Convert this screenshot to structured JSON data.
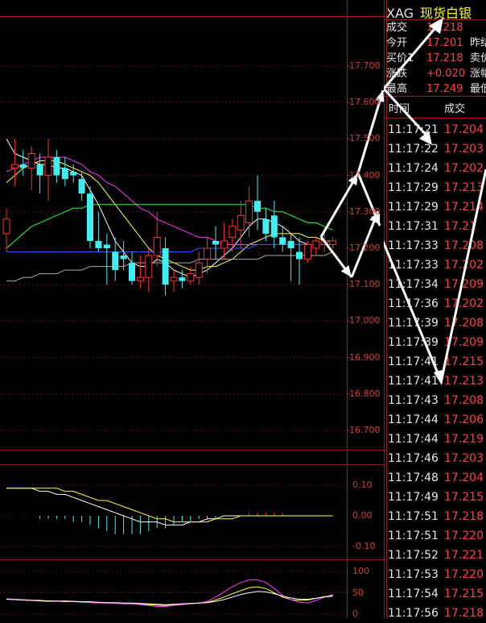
{
  "colors": {
    "up": "#ff3030",
    "down": "#40f0f0",
    "grid": "#8b1a1a",
    "ma5": "#ffffff",
    "ma10": "#ffff33",
    "ma20": "#ff33ff",
    "ma40": "#33ff33",
    "ma60": "#3355ff",
    "ma120": "#aaaaaa",
    "price_text": "#ff4040",
    "label_text": "#e6e6e6",
    "symbol_name": "#ffff00"
  },
  "header": {
    "symbol": "XAG",
    "name": "现货白银"
  },
  "quote": [
    {
      "label": "成交",
      "value": "17.218",
      "label2": ""
    },
    {
      "label": "今开",
      "value": "17.201",
      "label2": "昨结"
    },
    {
      "label": "买价1",
      "value": "17.218",
      "label2": "卖价"
    },
    {
      "label": "涨跌",
      "value": "+0.020",
      "label2": "涨幅"
    },
    {
      "label": "最高",
      "value": "17.249",
      "label2": "最低"
    }
  ],
  "ticks_header": {
    "time": "时间",
    "price": "成交"
  },
  "ticks": [
    {
      "time": "11:17:21",
      "price": "17.204"
    },
    {
      "time": "11:17:22",
      "price": "17.203"
    },
    {
      "time": "11:17:24",
      "price": "17.202"
    },
    {
      "time": "11:17:29",
      "price": "17.213"
    },
    {
      "time": "11:17:29",
      "price": "17.214"
    },
    {
      "time": "11:17:31",
      "price": "17.21"
    },
    {
      "time": "11:17:33",
      "price": "17.208"
    },
    {
      "time": "11:17:33",
      "price": "17.202"
    },
    {
      "time": "11:17:34",
      "price": "17.209"
    },
    {
      "time": "11:17:36",
      "price": "17.202"
    },
    {
      "time": "11:17:39",
      "price": "17.208"
    },
    {
      "time": "11:17:39",
      "price": "17.209"
    },
    {
      "time": "11:17:41",
      "price": "17.215"
    },
    {
      "time": "11:17:41",
      "price": "17.213"
    },
    {
      "time": "11:17:43",
      "price": "17.208"
    },
    {
      "time": "11:17:44",
      "price": "17.206"
    },
    {
      "time": "11:17:44",
      "price": "17.219"
    },
    {
      "time": "11:17:46",
      "price": "17.203"
    },
    {
      "time": "11:17:48",
      "price": "17.204"
    },
    {
      "time": "11:17:49",
      "price": "17.215"
    },
    {
      "time": "11:17:51",
      "price": "17.218"
    },
    {
      "time": "11:17:51",
      "price": "17.220"
    },
    {
      "time": "11:17:52",
      "price": "17.221"
    },
    {
      "time": "11:17:53",
      "price": "17.220"
    },
    {
      "time": "11:17:54",
      "price": "17.215"
    },
    {
      "time": "11:17:56",
      "price": "17.218"
    }
  ],
  "chart_data": [
    {
      "type": "candlestick",
      "y_ticks": [
        "17.700",
        "17.600",
        "17.500",
        "17.400",
        "17.300",
        "17.200",
        "17.100",
        "17.000",
        "16.900",
        "16.800",
        "16.700"
      ],
      "ylim": [
        16.66,
        17.79
      ],
      "candles": [
        {
          "o": 17.24,
          "h": 17.31,
          "l": 17.19,
          "c": 17.28
        },
        {
          "o": 17.42,
          "h": 17.5,
          "l": 17.37,
          "c": 17.43
        },
        {
          "o": 17.43,
          "h": 17.47,
          "l": 17.4,
          "c": 17.42
        },
        {
          "o": 17.42,
          "h": 17.48,
          "l": 17.36,
          "c": 17.46
        },
        {
          "o": 17.43,
          "h": 17.46,
          "l": 17.35,
          "c": 17.4
        },
        {
          "o": 17.4,
          "h": 17.5,
          "l": 17.33,
          "c": 17.45
        },
        {
          "o": 17.45,
          "h": 17.47,
          "l": 17.38,
          "c": 17.4
        },
        {
          "o": 17.42,
          "h": 17.45,
          "l": 17.37,
          "c": 17.39
        },
        {
          "o": 17.41,
          "h": 17.43,
          "l": 17.38,
          "c": 17.4
        },
        {
          "o": 17.39,
          "h": 17.41,
          "l": 17.33,
          "c": 17.35
        },
        {
          "o": 17.35,
          "h": 17.37,
          "l": 17.2,
          "c": 17.22
        },
        {
          "o": 17.22,
          "h": 17.3,
          "l": 17.19,
          "c": 17.2
        },
        {
          "o": 17.21,
          "h": 17.24,
          "l": 17.1,
          "c": 17.2
        },
        {
          "o": 17.19,
          "h": 17.23,
          "l": 17.11,
          "c": 17.14
        },
        {
          "o": 17.18,
          "h": 17.22,
          "l": 17.14,
          "c": 17.17
        },
        {
          "o": 17.16,
          "h": 17.19,
          "l": 17.1,
          "c": 17.11
        },
        {
          "o": 17.11,
          "h": 17.18,
          "l": 17.09,
          "c": 17.12
        },
        {
          "o": 17.12,
          "h": 17.2,
          "l": 17.08,
          "c": 17.18
        },
        {
          "o": 17.18,
          "h": 17.3,
          "l": 17.15,
          "c": 17.23
        },
        {
          "o": 17.2,
          "h": 17.23,
          "l": 17.07,
          "c": 17.1
        },
        {
          "o": 17.11,
          "h": 17.14,
          "l": 17.08,
          "c": 17.12
        },
        {
          "o": 17.12,
          "h": 17.14,
          "l": 17.09,
          "c": 17.11
        },
        {
          "o": 17.11,
          "h": 17.15,
          "l": 17.1,
          "c": 17.13
        },
        {
          "o": 17.12,
          "h": 17.19,
          "l": 17.1,
          "c": 17.16
        },
        {
          "o": 17.17,
          "h": 17.23,
          "l": 17.13,
          "c": 17.2
        },
        {
          "o": 17.22,
          "h": 17.26,
          "l": 17.17,
          "c": 17.21
        },
        {
          "o": 17.2,
          "h": 17.27,
          "l": 17.17,
          "c": 17.22
        },
        {
          "o": 17.23,
          "h": 17.28,
          "l": 17.19,
          "c": 17.26
        },
        {
          "o": 17.25,
          "h": 17.33,
          "l": 17.2,
          "c": 17.29
        },
        {
          "o": 17.27,
          "h": 17.37,
          "l": 17.23,
          "c": 17.33
        },
        {
          "o": 17.33,
          "h": 17.4,
          "l": 17.25,
          "c": 17.3
        },
        {
          "o": 17.28,
          "h": 17.31,
          "l": 17.22,
          "c": 17.24
        },
        {
          "o": 17.29,
          "h": 17.33,
          "l": 17.2,
          "c": 17.23
        },
        {
          "o": 17.23,
          "h": 17.26,
          "l": 17.19,
          "c": 17.21
        },
        {
          "o": 17.22,
          "h": 17.24,
          "l": 17.11,
          "c": 17.2
        },
        {
          "o": 17.19,
          "h": 17.23,
          "l": 17.1,
          "c": 17.17
        },
        {
          "o": 17.17,
          "h": 17.22,
          "l": 17.16,
          "c": 17.21
        },
        {
          "o": 17.2,
          "h": 17.23,
          "l": 17.18,
          "c": 17.22
        },
        {
          "o": 17.21,
          "h": 17.24,
          "l": 17.19,
          "c": 17.22
        },
        {
          "o": 17.21,
          "h": 17.23,
          "l": 17.2,
          "c": 17.22
        }
      ],
      "ma_lines": [
        {
          "color_key": "ma5",
          "values": [
            17.5,
            17.46,
            17.45,
            17.44,
            17.43,
            17.43,
            17.42,
            17.42,
            17.41,
            17.4,
            17.36,
            17.32,
            17.27,
            17.22,
            17.19,
            17.16,
            17.15,
            17.15,
            17.17,
            17.16,
            17.14,
            17.13,
            17.12,
            17.13,
            17.14,
            17.16,
            17.18,
            17.2,
            17.23,
            17.26,
            17.28,
            17.28,
            17.27,
            17.26,
            17.24,
            17.22,
            17.21,
            17.21,
            17.21,
            17.21
          ]
        },
        {
          "color_key": "ma10",
          "values": [
            17.38,
            17.4,
            17.42,
            17.43,
            17.44,
            17.44,
            17.44,
            17.43,
            17.42,
            17.41,
            17.4,
            17.38,
            17.35,
            17.32,
            17.29,
            17.26,
            17.23,
            17.2,
            17.18,
            17.17,
            17.16,
            17.15,
            17.14,
            17.14,
            17.15,
            17.15,
            17.16,
            17.17,
            17.19,
            17.21,
            17.22,
            17.23,
            17.24,
            17.24,
            17.24,
            17.24,
            17.23,
            17.23,
            17.22,
            17.22
          ]
        },
        {
          "color_key": "ma20",
          "values": [
            17.41,
            17.42,
            17.43,
            17.44,
            17.45,
            17.45,
            17.45,
            17.45,
            17.44,
            17.43,
            17.41,
            17.4,
            17.38,
            17.37,
            17.35,
            17.33,
            17.31,
            17.3,
            17.28,
            17.27,
            17.26,
            17.25,
            17.24,
            17.23,
            17.23,
            17.22,
            17.21,
            17.21,
            17.21,
            17.21,
            17.21,
            17.21,
            17.21,
            17.21,
            17.21,
            17.21,
            17.21,
            17.21,
            17.21,
            17.21
          ]
        },
        {
          "color_key": "ma40",
          "values": [
            17.2,
            17.22,
            17.24,
            17.26,
            17.27,
            17.28,
            17.29,
            17.3,
            17.31,
            17.31,
            17.32,
            17.32,
            17.32,
            17.32,
            17.32,
            17.32,
            17.32,
            17.32,
            17.32,
            17.32,
            17.32,
            17.32,
            17.32,
            17.32,
            17.32,
            17.32,
            17.32,
            17.32,
            17.32,
            17.32,
            17.31,
            17.31,
            17.3,
            17.3,
            17.29,
            17.28,
            17.27,
            17.27,
            17.26,
            17.25
          ]
        },
        {
          "color_key": "ma60",
          "values": [
            17.19,
            17.19,
            17.19,
            17.19,
            17.19,
            17.19,
            17.19,
            17.19,
            17.19,
            17.19,
            17.19,
            17.19,
            17.19,
            17.19,
            17.19,
            17.19,
            17.19,
            17.19,
            17.19,
            17.19,
            17.19,
            17.19,
            17.19,
            17.2,
            17.2,
            17.2,
            17.2,
            17.2,
            17.2,
            17.2,
            17.21,
            17.21,
            17.21,
            17.21,
            17.21,
            17.21,
            17.21,
            17.21,
            17.21,
            17.21
          ]
        },
        {
          "color_key": "ma120",
          "values": [
            17.11,
            17.11,
            17.12,
            17.12,
            17.13,
            17.13,
            17.13,
            17.14,
            17.14,
            17.14,
            17.15,
            17.15,
            17.15,
            17.15,
            17.15,
            17.16,
            17.16,
            17.16,
            17.16,
            17.16,
            17.16,
            17.16,
            17.16,
            17.17,
            17.17,
            17.17,
            17.17,
            17.17,
            17.17,
            17.17,
            17.17,
            17.18,
            17.18,
            17.18,
            17.18,
            17.18,
            17.18,
            17.18,
            17.18,
            17.19
          ]
        }
      ]
    },
    {
      "type": "macd",
      "y_ticks": [
        "0.10",
        "0.00",
        "-0.10"
      ],
      "ylim": [
        -0.14,
        0.15
      ],
      "dif": [
        0.09,
        0.09,
        0.09,
        0.09,
        0.08,
        0.08,
        0.07,
        0.07,
        0.06,
        0.05,
        0.04,
        0.03,
        0.02,
        0.01,
        0.0,
        -0.01,
        -0.02,
        -0.02,
        -0.02,
        -0.03,
        -0.03,
        -0.03,
        -0.02,
        -0.02,
        -0.01,
        -0.01,
        0.0,
        0.0,
        0.0,
        0.0,
        0.0,
        0.0,
        0.0,
        0.0,
        0.0,
        0.0,
        0.0,
        0.0,
        0.0,
        0.0
      ],
      "dea": [
        0.09,
        0.09,
        0.09,
        0.09,
        0.09,
        0.09,
        0.09,
        0.08,
        0.08,
        0.07,
        0.06,
        0.05,
        0.05,
        0.04,
        0.03,
        0.02,
        0.01,
        0.0,
        -0.01,
        -0.01,
        -0.02,
        -0.02,
        -0.02,
        -0.02,
        -0.02,
        -0.01,
        -0.01,
        -0.01,
        0.0,
        0.0,
        0.0,
        0.0,
        0.0,
        0.0,
        0.0,
        0.0,
        0.0,
        0.0,
        0.0,
        0.0
      ],
      "hist": [
        0.0,
        0.0,
        0.0,
        0.0,
        -0.01,
        -0.01,
        -0.01,
        -0.01,
        -0.02,
        -0.02,
        -0.03,
        -0.04,
        -0.05,
        -0.06,
        -0.06,
        -0.06,
        -0.06,
        -0.05,
        -0.04,
        -0.04,
        -0.03,
        -0.02,
        -0.02,
        -0.01,
        -0.01,
        -0.01,
        0.0,
        0.0,
        0.0,
        0.01,
        0.01,
        0.01,
        0.01,
        0.01,
        0.0,
        0.0,
        0.0,
        0.0,
        0.0,
        0.0
      ]
    },
    {
      "type": "line",
      "y_ticks": [
        "100",
        "50",
        "0"
      ],
      "ylim": [
        -5,
        110
      ],
      "series": [
        {
          "color_key": "ma10",
          "values": [
            35,
            34,
            33,
            32,
            31,
            30,
            30,
            31,
            30,
            29,
            28,
            27,
            26,
            26,
            25,
            25,
            24,
            22,
            21,
            20,
            22,
            24,
            25,
            26,
            28,
            33,
            40,
            48,
            55,
            62,
            64,
            60,
            50,
            40,
            34,
            32,
            33,
            37,
            41,
            44
          ]
        },
        {
          "color_key": "ma20",
          "values": [
            36,
            35,
            34,
            33,
            32,
            31,
            30,
            29,
            29,
            28,
            27,
            26,
            26,
            25,
            24,
            24,
            22,
            20,
            18,
            18,
            20,
            22,
            24,
            26,
            30,
            40,
            52,
            64,
            74,
            80,
            80,
            74,
            60,
            44,
            34,
            28,
            26,
            32,
            40,
            46
          ]
        },
        {
          "color_key": "ma5",
          "values": [
            35,
            34,
            33,
            32,
            32,
            31,
            31,
            30,
            30,
            29,
            29,
            28,
            27,
            27,
            26,
            26,
            25,
            24,
            23,
            22,
            23,
            24,
            25,
            26,
            27,
            30,
            34,
            40,
            46,
            50,
            53,
            52,
            48,
            42,
            38,
            35,
            35,
            37,
            40,
            42
          ]
        }
      ]
    }
  ]
}
